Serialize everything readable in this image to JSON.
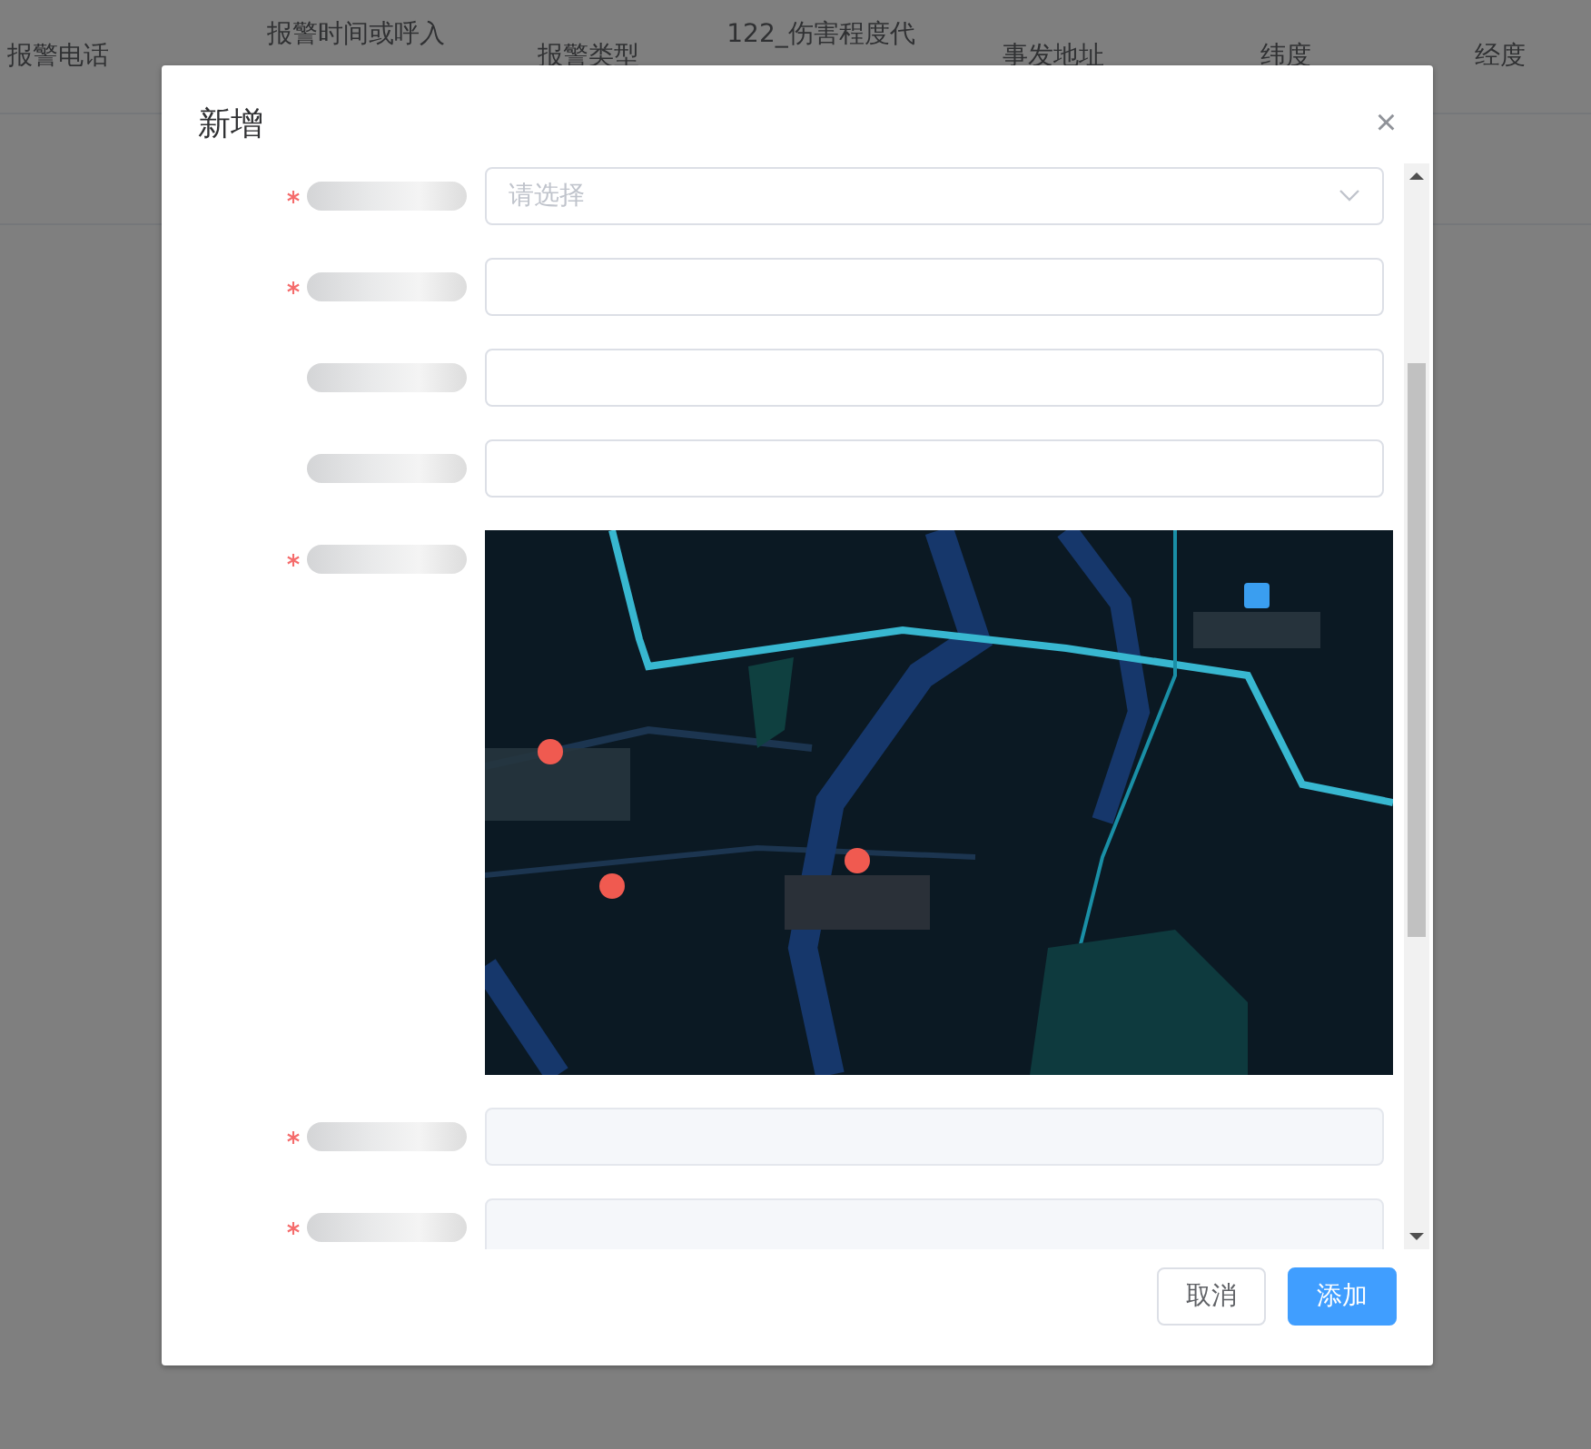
{
  "table": {
    "columns": [
      "报警电话",
      "报警时间或呼入",
      "报警类型",
      "122_伤害程度代",
      "事发地址",
      "纬度",
      "经度"
    ]
  },
  "dialog": {
    "title": "新增",
    "close": "×",
    "fields": [
      {
        "kind": "select",
        "required": true,
        "placeholder": "请选择"
      },
      {
        "kind": "text",
        "required": true
      },
      {
        "kind": "text",
        "required": false
      },
      {
        "kind": "text",
        "required": false
      },
      {
        "kind": "map",
        "required": true
      },
      {
        "kind": "readonly",
        "required": true
      },
      {
        "kind": "readonly",
        "required": true
      }
    ],
    "buttons": [
      {
        "label": "取消",
        "kind": "default"
      },
      {
        "label": "添加",
        "kind": "primary"
      }
    ]
  }
}
